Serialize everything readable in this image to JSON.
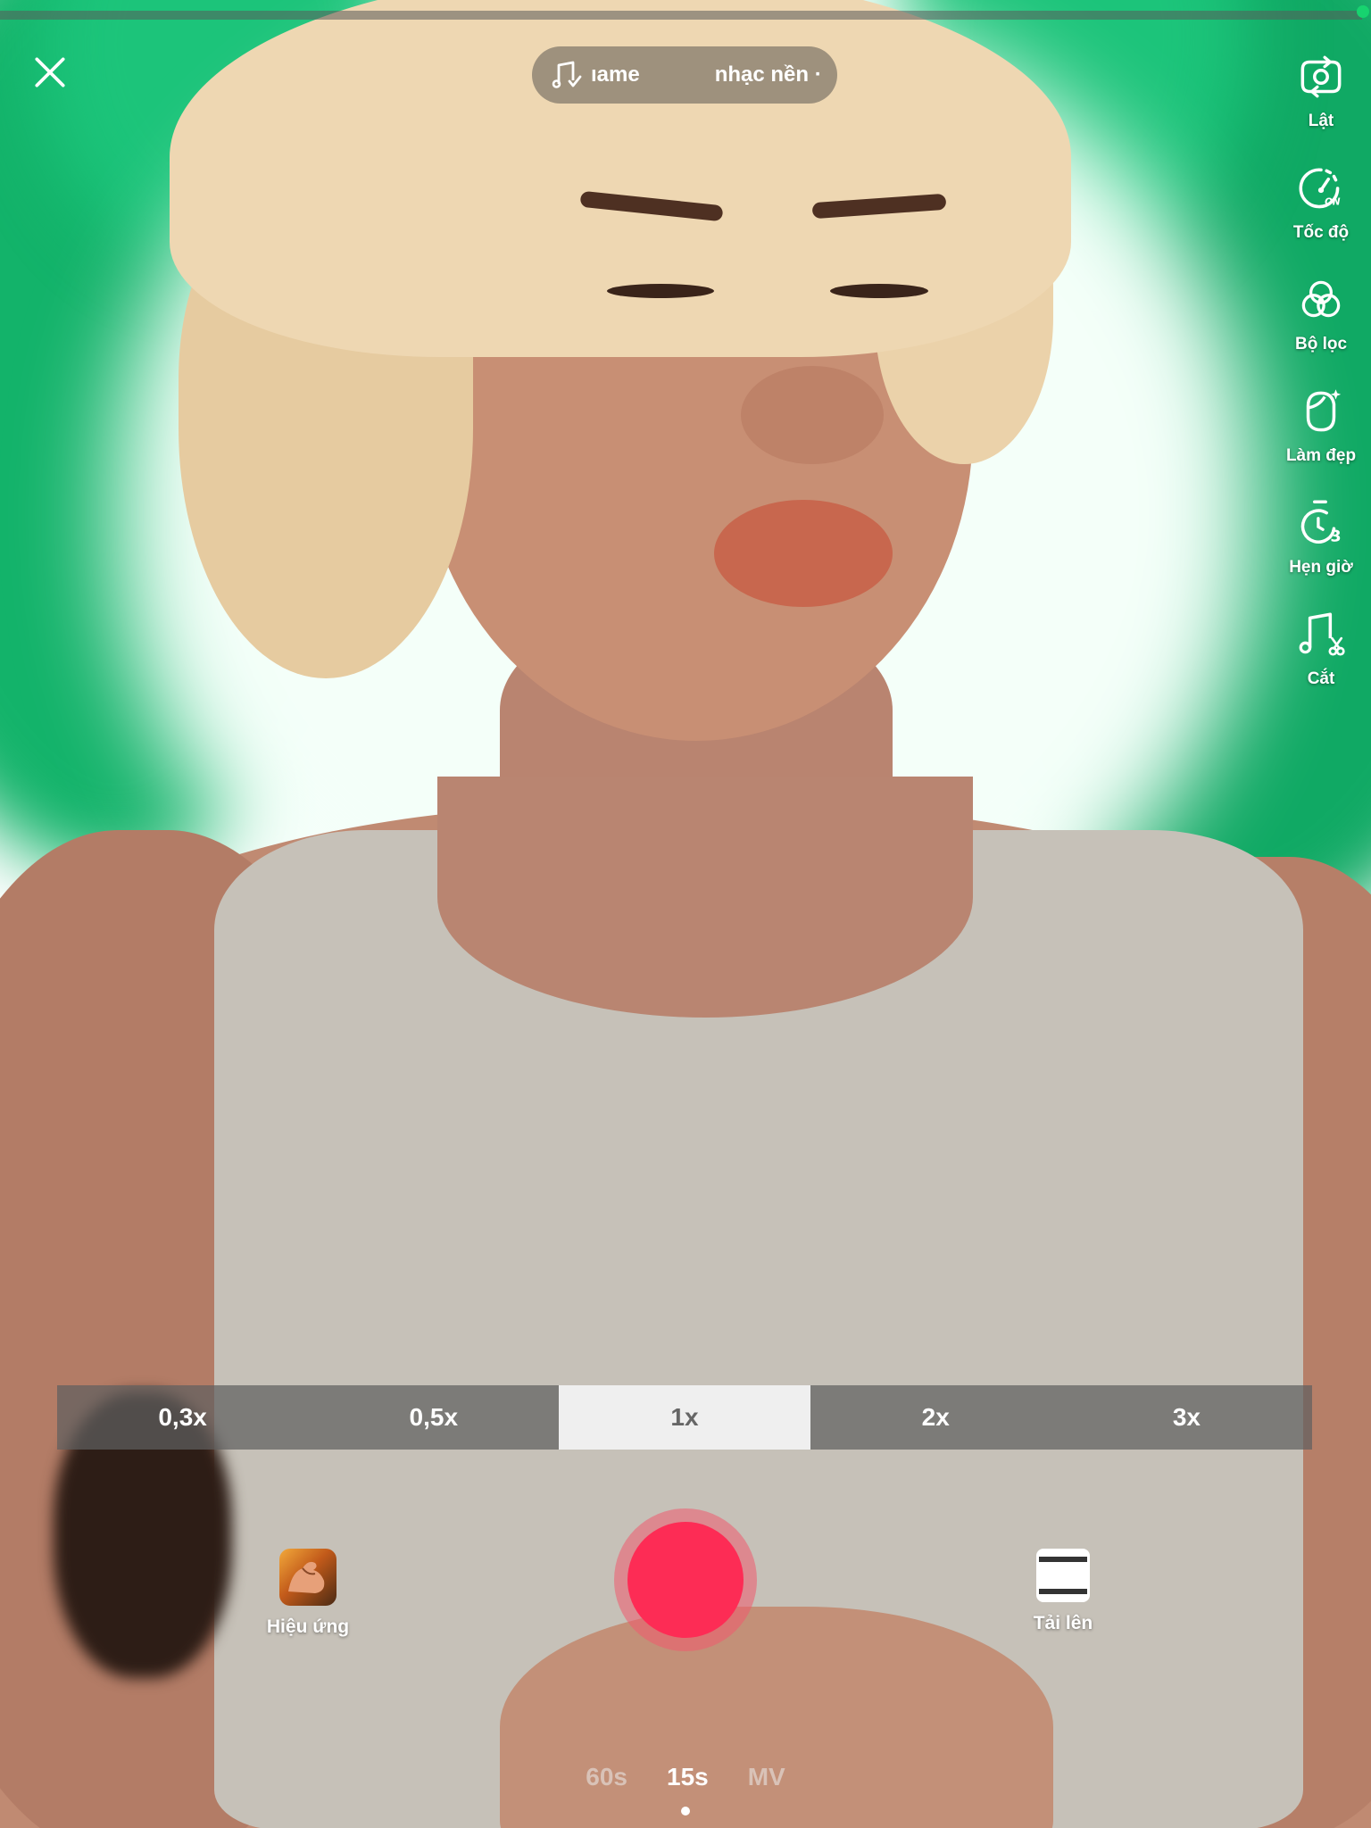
{
  "top_bar": {
    "sound_text_left": "ıame",
    "sound_text_right": "nhạc nền ·"
  },
  "tools": [
    {
      "icon": "flip-camera-icon",
      "label": "Lật"
    },
    {
      "icon": "speed-icon",
      "label": "Tốc độ"
    },
    {
      "icon": "filters-icon",
      "label": "Bộ lọc"
    },
    {
      "icon": "beautify-icon",
      "label": "Làm đẹp"
    },
    {
      "icon": "timer-icon",
      "label": "Hẹn giờ"
    },
    {
      "icon": "music-cut-icon",
      "label": "Cắt"
    }
  ],
  "zoom": {
    "options": [
      "0,3x",
      "0,5x",
      "1x",
      "2x",
      "3x"
    ],
    "selected": "1x"
  },
  "bottom": {
    "effects_label": "Hiệu ứng",
    "upload_label": "Tải lên"
  },
  "modes": {
    "options": [
      "60s",
      "15s",
      "MV"
    ],
    "selected": "15s"
  },
  "colors": {
    "record_red": "#fd2c55",
    "background_glow_green": "#13b36a",
    "recording_indicator_green": "#17d36f"
  }
}
